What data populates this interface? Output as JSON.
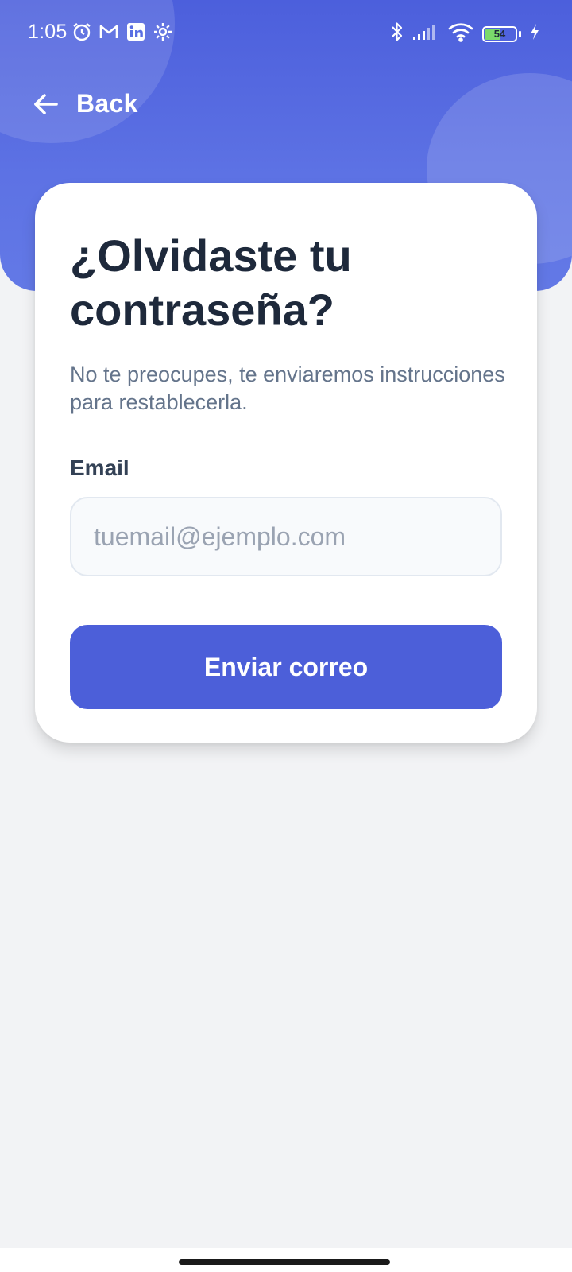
{
  "status_bar": {
    "time": "1:05",
    "left_icons": [
      "alarm-icon",
      "gmail-icon",
      "linkedin-icon",
      "settings-gear-icon"
    ],
    "right_icons": [
      "bluetooth-icon",
      "cellular-signal-icon",
      "wifi-icon",
      "battery-icon",
      "charging-bolt-icon"
    ],
    "battery_level": "54"
  },
  "nav": {
    "back_label": "Back"
  },
  "form": {
    "title": "¿Olvidaste tu contraseña?",
    "subtitle": "No te preocupes, te enviaremos instrucciones para restablecerla.",
    "email_label": "Email",
    "email_placeholder": "tuemail@ejemplo.com",
    "email_value": "",
    "submit_label": "Enviar correo"
  },
  "colors": {
    "primary": "#4c5fd9",
    "header_gradient_top": "#4c5fdc",
    "header_gradient_bottom": "#6379e6",
    "background": "#f2f3f5",
    "title_text": "#1e293b",
    "subtitle_text": "#64748b",
    "battery_fill": "#7bd96b"
  }
}
